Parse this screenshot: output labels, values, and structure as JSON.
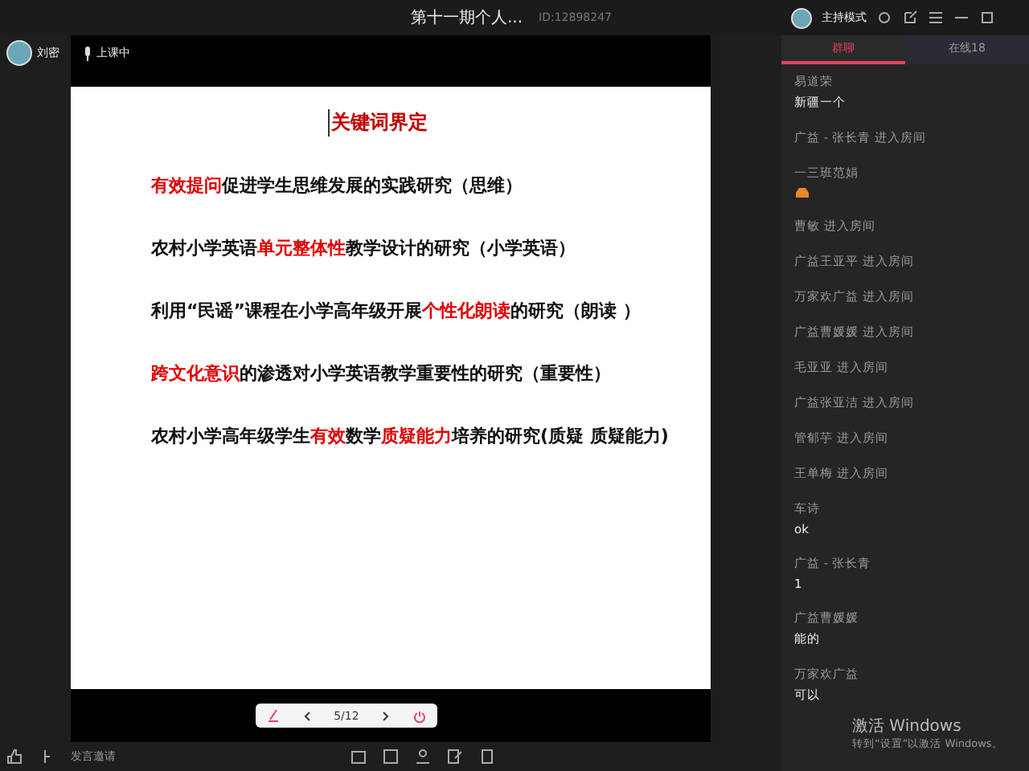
{
  "window": {
    "title": "第十一期个人...",
    "room_id": "ID:12898247"
  },
  "host": {
    "mode": "主持模式"
  },
  "presenter": {
    "name": "刘密",
    "status": "上课中"
  },
  "slide": {
    "title": "关键词界定",
    "lines": [
      [
        {
          "text": "有效提问",
          "emphasis": true
        },
        {
          "text": "促进学生思维发展的实践研究（思维）",
          "emphasis": false
        }
      ],
      [
        {
          "text": "农村小学英语",
          "emphasis": false
        },
        {
          "text": "单元整体性",
          "emphasis": true
        },
        {
          "text": "教学设计的研究（小学英语）",
          "emphasis": false
        }
      ],
      [
        {
          "text": "利用“民谣”课程在小学高年级开展",
          "emphasis": false
        },
        {
          "text": "个性化朗读",
          "emphasis": true
        },
        {
          "text": "的研究（朗读 ）",
          "emphasis": false
        }
      ],
      [
        {
          "text": "跨文化意识",
          "emphasis": true
        },
        {
          "text": "的渗透对小学英语教学重要性的研究（重要性）",
          "emphasis": false
        }
      ],
      [
        {
          "text": "农村小学高年级学生",
          "emphasis": false
        },
        {
          "text": "有效",
          "emphasis": true
        },
        {
          "text": "数学",
          "emphasis": false
        },
        {
          "text": "质疑能力",
          "emphasis": true
        },
        {
          "text": "培养的研究(质疑 质疑能力)",
          "emphasis": false
        }
      ]
    ]
  },
  "slide_controls": {
    "page": "5/12"
  },
  "bottom_bar": {
    "speak_label": "发言邀请"
  },
  "chat": {
    "tabs": [
      {
        "label": "群聊",
        "selected": true
      },
      {
        "label": "在线18",
        "selected": false
      }
    ],
    "messages": [
      {
        "kind": "chat",
        "name": "易道荣",
        "text": "新疆一个"
      },
      {
        "kind": "join",
        "text": "广益 - 张长青 进入房间"
      },
      {
        "kind": "sticker",
        "name": "一三班范娟"
      },
      {
        "kind": "join",
        "text": "曹敏 进入房间"
      },
      {
        "kind": "join",
        "text": "广益王亚平 进入房间"
      },
      {
        "kind": "join",
        "text": "万家欢广益 进入房间"
      },
      {
        "kind": "join",
        "text": "广益曹媛媛 进入房间"
      },
      {
        "kind": "join",
        "text": "毛亚亚 进入房间"
      },
      {
        "kind": "join",
        "text": "广益张亚洁 进入房间"
      },
      {
        "kind": "join",
        "text": "管郁芋 进入房间"
      },
      {
        "kind": "join",
        "text": "王单梅 进入房间"
      },
      {
        "kind": "chat",
        "name": "车诗",
        "text": "ok"
      },
      {
        "kind": "chat",
        "name": "广益 - 张长青",
        "text": "1"
      },
      {
        "kind": "chat",
        "name": "广益曹媛媛",
        "text": "能的"
      },
      {
        "kind": "chat",
        "name": "万家欢广益",
        "text": "可以"
      }
    ]
  },
  "os_notice": {
    "title": "激活 Windows",
    "subtitle": "转到“设置”以激活 Windows。"
  }
}
